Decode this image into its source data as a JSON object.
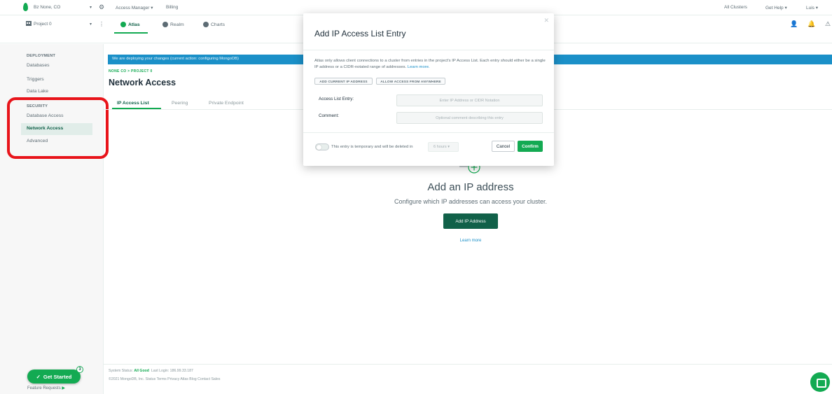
{
  "topbar": {
    "org_name": "Bz None, CO",
    "access_manager": "Access Manager",
    "billing": "Billing",
    "all_clusters": "All Clusters",
    "get_help": "Get Help",
    "user": "Luis"
  },
  "projectbar": {
    "project_name": "Project 0",
    "tabs": [
      {
        "label": "Atlas"
      },
      {
        "label": "Realm"
      },
      {
        "label": "Charts"
      }
    ]
  },
  "sidebar": {
    "deployment_heading": "DEPLOYMENT",
    "deployment_items": [
      "Databases",
      "Triggers",
      "Data Lake"
    ],
    "security_heading": "SECURITY",
    "security_items": [
      "Database Access",
      "Network Access",
      "Advanced"
    ]
  },
  "main": {
    "banner": "We are deploying your changes (current action: configuring MongoDB)",
    "breadcrumb": "NONE CO > PROJECT 0",
    "title": "Network Access",
    "tabs": [
      "IP Access List",
      "Peering",
      "Private Endpoint"
    ],
    "empty_title": "Add an IP address",
    "empty_desc": "Configure which IP addresses can access your cluster.",
    "add_button": "Add IP Address",
    "learn_more": "Learn more"
  },
  "modal": {
    "title": "Add IP Access List Entry",
    "description": "Atlas only allows client connections to a cluster from entries in the project's IP Access List. Each entry should either be a single IP address or a CIDR-notated range of addresses.",
    "learn_more": "Learn more.",
    "add_current_ip": "ADD CURRENT IP ADDRESS",
    "allow_anywhere": "ALLOW ACCESS FROM ANYWHERE",
    "entry_label": "Access List Entry:",
    "entry_placeholder": "Enter IP Address or CIDR Notation",
    "comment_label": "Comment:",
    "comment_placeholder": "Optional comment describing this entry",
    "temporary_text": "This entry is temporary and will be deleted in",
    "hours_value": "6 hours",
    "cancel": "Cancel",
    "confirm": "Confirm"
  },
  "footer": {
    "status_label": "System Status:",
    "status_value": "All Good",
    "last_login": "Last Login: 186.99.33.187",
    "links": "©2021 MongoDB, Inc.   Status   Terms   Privacy   Atlas Blog   Contact Sales"
  },
  "get_started": {
    "label": "Get Started",
    "badge": "3"
  },
  "feature_requests": "Feature Requests",
  "colors": {
    "brand_green": "#13aa52",
    "dark_green": "#116149",
    "banner_blue": "#1b90c8",
    "highlight_red": "#e8141a"
  }
}
